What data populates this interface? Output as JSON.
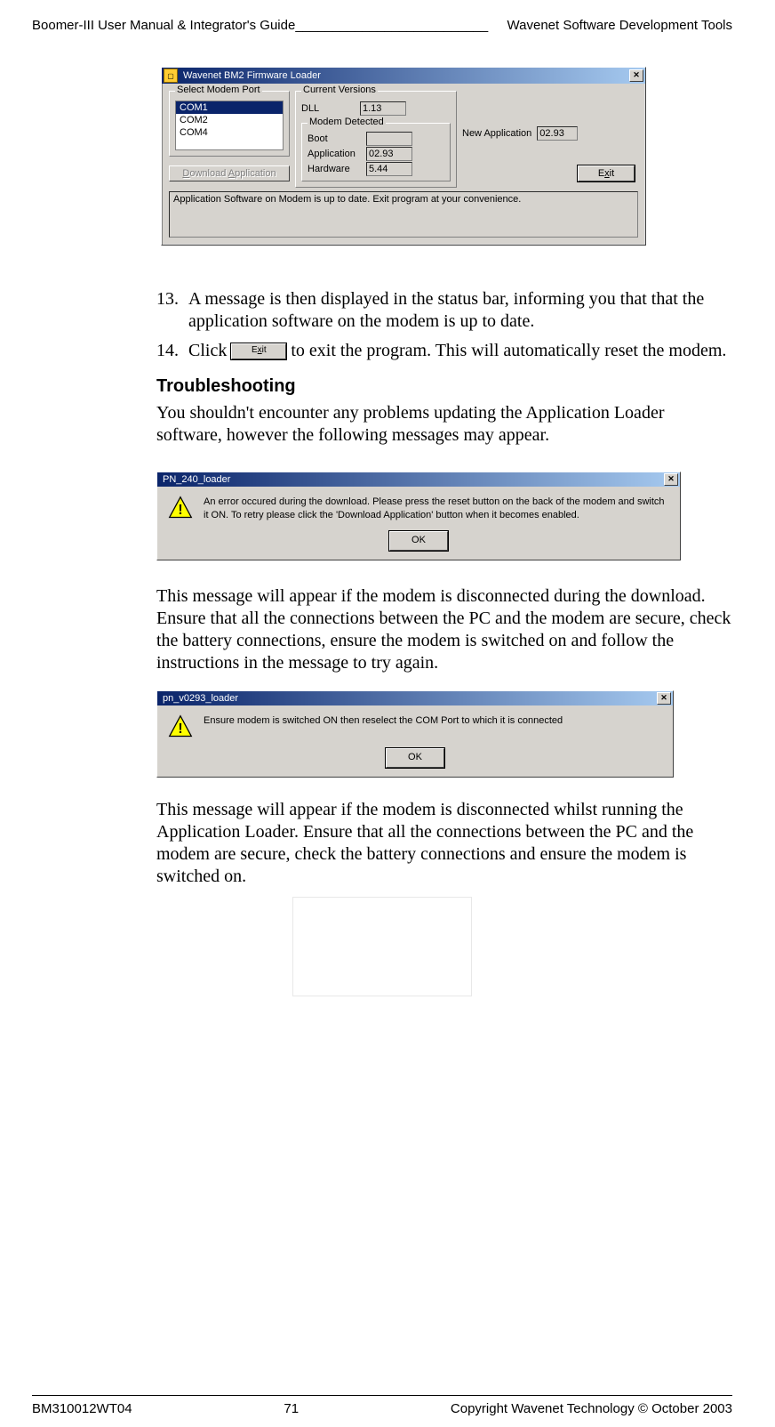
{
  "header": {
    "left": "Boomer-III User Manual & Integrator's Guide",
    "right": "Wavenet Software Development Tools"
  },
  "footer": {
    "left": "BM310012WT04",
    "center": "71",
    "right": "Copyright Wavenet Technology © October 2003"
  },
  "firmware_loader": {
    "window_title": "Wavenet BM2 Firmware Loader",
    "select_modem_port_legend": "Select Modem Port",
    "ports": [
      "COM1",
      "COM2",
      "COM4"
    ],
    "current_versions_legend": "Current Versions",
    "dll_label": "DLL",
    "dll_value": "1.13",
    "modem_detected_legend": "Modem Detected",
    "boot_label": "Boot",
    "boot_value": "",
    "application_label": "Application",
    "application_value": "02.93",
    "hardware_label": "Hardware",
    "hardware_value": "5.44",
    "new_application_label": "New Application",
    "new_application_value": "02.93",
    "download_btn": "Download Application",
    "exit_btn_prefix": "E",
    "exit_btn_accel": "x",
    "exit_btn_suffix": "it",
    "status_text": "Application Software on Modem is up to date. Exit program at your convenience."
  },
  "steps": {
    "s13_num": "13.",
    "s13_text": "A message is then displayed in the status bar, informing you that that the application software on the modem is up to date.",
    "s14_num": "14.",
    "s14_text_before": "Click ",
    "s14_btn_prefix": "E",
    "s14_btn_accel": "x",
    "s14_btn_suffix": "it",
    "s14_text_after": " to exit the program. This will automatically reset the modem."
  },
  "troubleshooting": {
    "heading": "Troubleshooting",
    "intro": "You shouldn't encounter any problems updating the Application Loader software, however the following messages may appear."
  },
  "msgbox1": {
    "title": "PN_240_loader",
    "text": "An error occured during the download. Please press the reset button on the back of the modem and switch it ON. To retry please click the 'Download Application' button when it becomes enabled.",
    "ok": "OK"
  },
  "msg1_explain": "This message will appear if the modem is disconnected during the download. Ensure that all the connections between the PC and the modem are secure, check the battery connections, ensure the modem is switched on and follow the instructions in the message to try again.",
  "msgbox2": {
    "title": "pn_v0293_loader",
    "text": "Ensure modem is switched ON then reselect the COM Port to which it is connected",
    "ok": "OK"
  },
  "msg2_explain": "This message will appear if the modem is disconnected whilst running the Application Loader. Ensure that all the connections between the PC and the modem are secure, check the battery connections and ensure the modem is switched on."
}
